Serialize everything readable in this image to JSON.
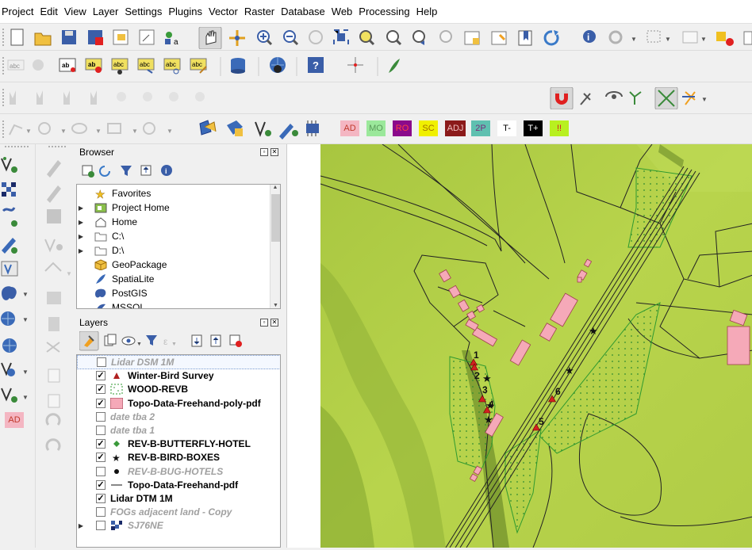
{
  "menu": [
    "Project",
    "Edit",
    "View",
    "Layer",
    "Settings",
    "Plugins",
    "Vector",
    "Raster",
    "Database",
    "Web",
    "Processing",
    "Help"
  ],
  "labels_toolbar": [
    {
      "text": "AD",
      "bg": "#f4b6c2",
      "fg": "#c0392b"
    },
    {
      "text": "MO",
      "bg": "#9be89b",
      "fg": "#5a9a5a"
    },
    {
      "text": "RO",
      "bg": "#8b0a8b",
      "fg": "#ff4040"
    },
    {
      "text": "SC",
      "bg": "#f0f000",
      "fg": "#a07000"
    },
    {
      "text": "ADJ",
      "bg": "#8b1a1a",
      "fg": "#f0c0c0"
    },
    {
      "text": "2P",
      "bg": "#5fc0b0",
      "fg": "#7a2a7a"
    },
    {
      "text": "T-",
      "bg": "#ffffff",
      "fg": "#000000"
    },
    {
      "text": "T+",
      "bg": "#000000",
      "fg": "#ffffff"
    },
    {
      "text": "!!",
      "bg": "#b8f020",
      "fg": "#d02020"
    }
  ],
  "left_toolbar_label": "AD",
  "browser": {
    "title": "Browser",
    "items": [
      {
        "label": "Favorites",
        "icon": "star-icon",
        "expandable": false
      },
      {
        "label": "Project Home",
        "icon": "project-home-icon",
        "expandable": true
      },
      {
        "label": "Home",
        "icon": "home-icon",
        "expandable": true
      },
      {
        "label": "C:\\",
        "icon": "folder-icon",
        "expandable": true
      },
      {
        "label": "D:\\",
        "icon": "folder-icon",
        "expandable": true
      },
      {
        "label": "GeoPackage",
        "icon": "geopackage-icon",
        "expandable": false
      },
      {
        "label": "SpatiaLite",
        "icon": "spatialite-icon",
        "expandable": false
      },
      {
        "label": "PostGIS",
        "icon": "postgis-icon",
        "expandable": false
      },
      {
        "label": "MSSQL",
        "icon": "mssql-icon",
        "expandable": false
      }
    ]
  },
  "layers": {
    "title": "Layers",
    "items": [
      {
        "label": "Lidar DSM 1M",
        "checked": false,
        "visible": false,
        "symbol": "none"
      },
      {
        "label": "Winter-Bird Survey",
        "checked": true,
        "visible": true,
        "symbol": "triangle"
      },
      {
        "label": "WOOD-REVB",
        "checked": true,
        "visible": true,
        "symbol": "dotted-poly"
      },
      {
        "label": "Topo-Data-Freehand-poly-pdf",
        "checked": true,
        "visible": true,
        "symbol": "pink-poly"
      },
      {
        "label": "date tba 2",
        "checked": false,
        "visible": false,
        "symbol": "none"
      },
      {
        "label": "date tba 1",
        "checked": false,
        "visible": false,
        "symbol": "none"
      },
      {
        "label": "REV-B-BUTTERFLY-HOTEL",
        "checked": true,
        "visible": true,
        "symbol": "green-diamond"
      },
      {
        "label": "REV-B-BIRD-BOXES",
        "checked": true,
        "visible": true,
        "symbol": "star"
      },
      {
        "label": "REV-B-BUG-HOTELS",
        "checked": false,
        "visible": false,
        "symbol": "dot"
      },
      {
        "label": "Topo-Data-Freehand-pdf",
        "checked": true,
        "visible": true,
        "symbol": "line"
      },
      {
        "label": "Lidar DTM 1M",
        "checked": true,
        "visible": true,
        "symbol": "none"
      },
      {
        "label": "FOGs adjacent land  - Copy",
        "checked": false,
        "visible": false,
        "symbol": "none"
      },
      {
        "label": "SJ76NE",
        "checked": false,
        "visible": false,
        "symbol": "raster"
      }
    ]
  },
  "map": {
    "survey_points": [
      "1",
      "2",
      "3",
      "4",
      "5",
      "6"
    ],
    "colors": {
      "terrain": "#b4d24a",
      "pink": "#f5a9b8",
      "wood": "#3c9b3c",
      "survey": "#d22020"
    }
  }
}
